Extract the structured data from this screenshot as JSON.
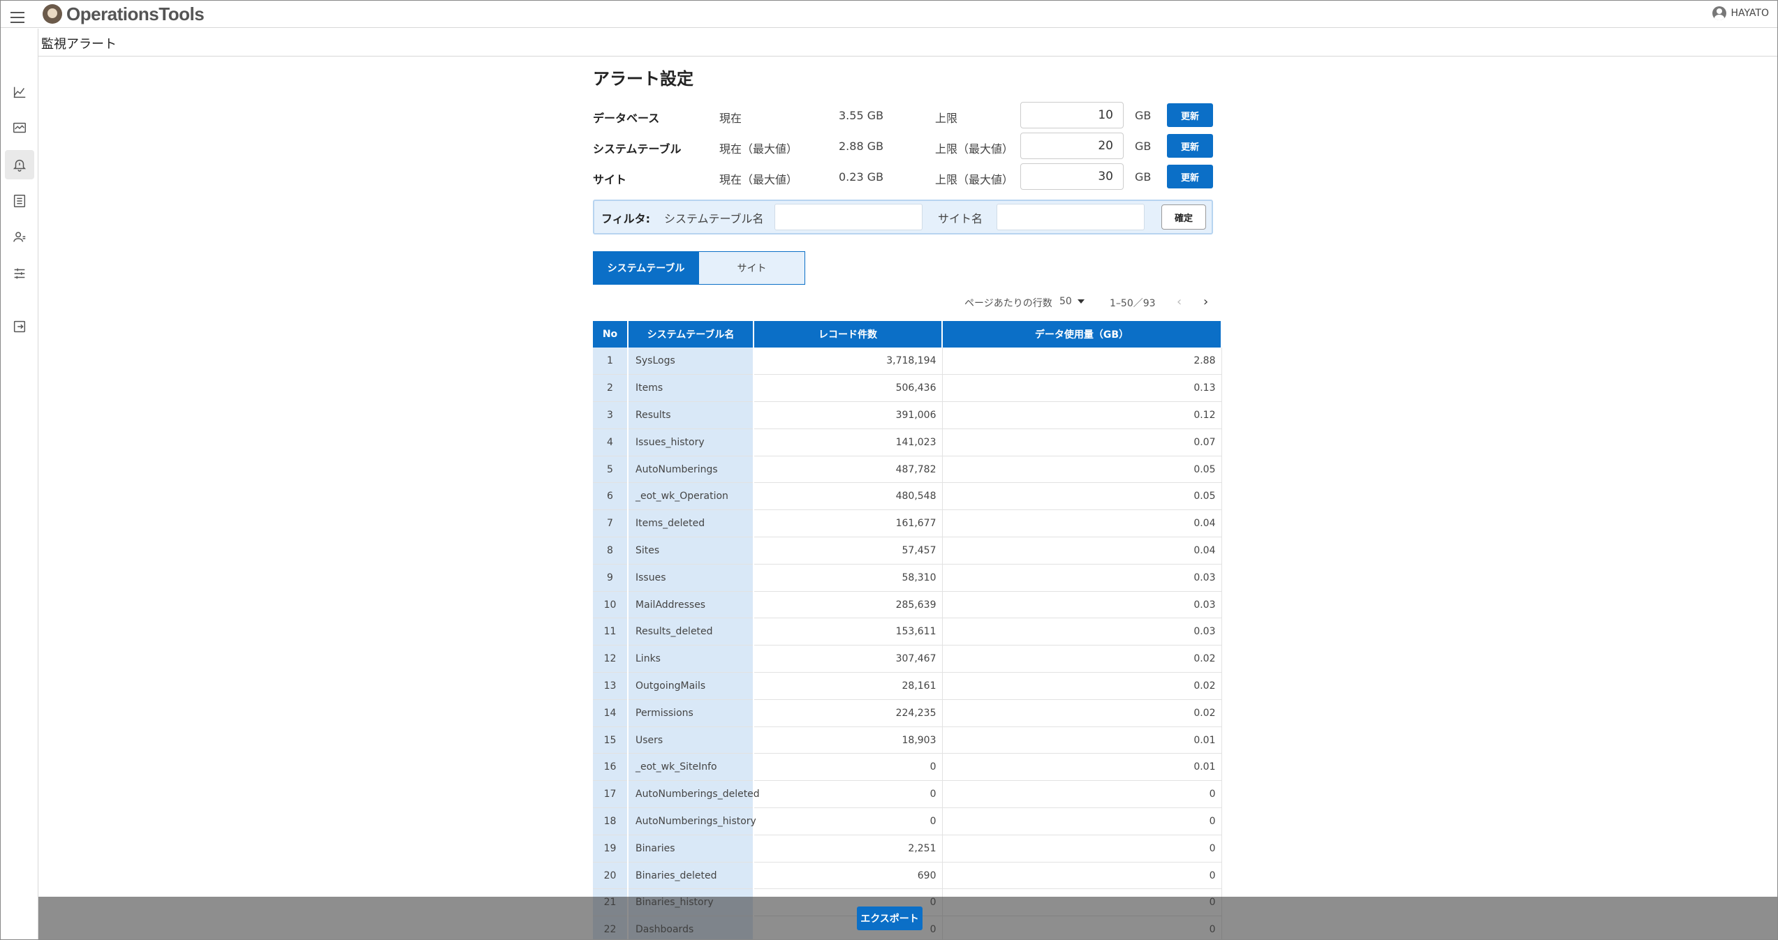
{
  "header": {
    "logo_text": "OperationsTools",
    "user_name": "HAYATO"
  },
  "breadcrumb": "監視アラート",
  "sidebar": {
    "items": [
      {
        "icon": "chart-line-icon"
      },
      {
        "icon": "monitor-icon"
      },
      {
        "icon": "alert-bell-icon",
        "active": true
      },
      {
        "icon": "list-icon"
      },
      {
        "icon": "user-settings-icon"
      },
      {
        "icon": "sliders-icon"
      },
      {
        "icon": "logout-icon"
      }
    ]
  },
  "main": {
    "title": "アラート設定",
    "alerts": [
      {
        "label": "データベース",
        "current_label": "現在",
        "current_value": "3.55 GB",
        "limit_label": "上限",
        "limit_value": "10",
        "unit": "GB",
        "button": "更新"
      },
      {
        "label": "システムテーブル",
        "current_label": "現在（最大値）",
        "current_value": "2.88 GB",
        "limit_label": "上限（最大値）",
        "limit_value": "20",
        "unit": "GB",
        "button": "更新"
      },
      {
        "label": "サイト",
        "current_label": "現在（最大値）",
        "current_value": "0.23 GB",
        "limit_label": "上限（最大値）",
        "limit_value": "30",
        "unit": "GB",
        "button": "更新"
      }
    ],
    "filter": {
      "label": "フィルタ:",
      "system_table_label": "システムテーブル名",
      "system_table_value": "",
      "site_label": "サイト名",
      "site_value": "",
      "button": "確定"
    },
    "tabs": [
      {
        "label": "システムテーブル",
        "active": true
      },
      {
        "label": "サイト",
        "active": false
      }
    ],
    "pager": {
      "rows_label": "ページあたりの行数",
      "rows_value": "50",
      "range": "1–50／93"
    },
    "table": {
      "headers": [
        "No",
        "システムテーブル名",
        "レコード件数",
        "データ使用量（GB）"
      ],
      "rows": [
        [
          "1",
          "SysLogs",
          "3,718,194",
          "2.88"
        ],
        [
          "2",
          "Items",
          "506,436",
          "0.13"
        ],
        [
          "3",
          "Results",
          "391,006",
          "0.12"
        ],
        [
          "4",
          "Issues_history",
          "141,023",
          "0.07"
        ],
        [
          "5",
          "AutoNumberings",
          "487,782",
          "0.05"
        ],
        [
          "6",
          "_eot_wk_Operation",
          "480,548",
          "0.05"
        ],
        [
          "7",
          "Items_deleted",
          "161,677",
          "0.04"
        ],
        [
          "8",
          "Sites",
          "57,457",
          "0.04"
        ],
        [
          "9",
          "Issues",
          "58,310",
          "0.03"
        ],
        [
          "10",
          "MailAddresses",
          "285,639",
          "0.03"
        ],
        [
          "11",
          "Results_deleted",
          "153,611",
          "0.03"
        ],
        [
          "12",
          "Links",
          "307,467",
          "0.02"
        ],
        [
          "13",
          "OutgoingMails",
          "28,161",
          "0.02"
        ],
        [
          "14",
          "Permissions",
          "224,235",
          "0.02"
        ],
        [
          "15",
          "Users",
          "18,903",
          "0.01"
        ],
        [
          "16",
          "_eot_wk_SiteInfo",
          "0",
          "0.01"
        ],
        [
          "17",
          "AutoNumberings_deleted",
          "0",
          "0"
        ],
        [
          "18",
          "AutoNumberings_history",
          "0",
          "0"
        ],
        [
          "19",
          "Binaries",
          "2,251",
          "0"
        ],
        [
          "20",
          "Binaries_deleted",
          "690",
          "0"
        ],
        [
          "21",
          "Binaries_history",
          "0",
          "0"
        ],
        [
          "22",
          "Dashboards",
          "0",
          "0"
        ]
      ]
    },
    "export_button": "エクスポート"
  },
  "colors": {
    "accent": "#0b6fc7",
    "highlight": "#d9e8f7"
  }
}
